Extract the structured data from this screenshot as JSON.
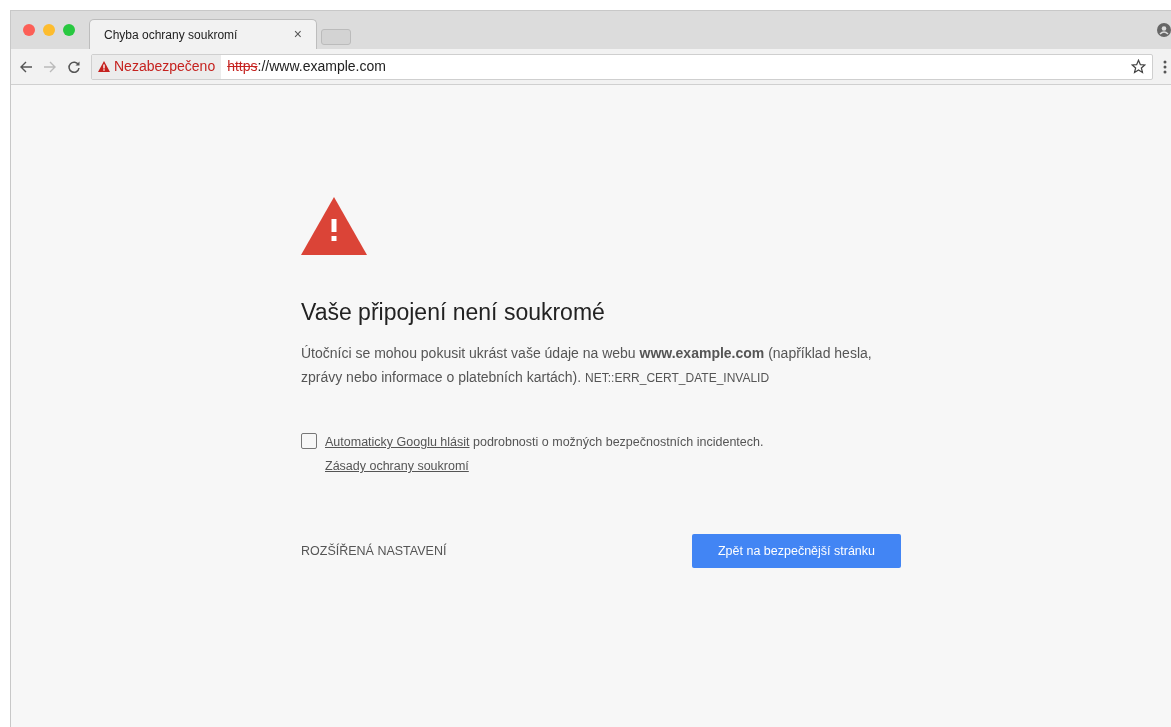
{
  "tabs": [
    {
      "title": "Chyba ochrany soukromí",
      "close": "×",
      "selected": true
    }
  ],
  "toolbar": {
    "security_label": "Nezabezpečeno",
    "url_scheme": "https",
    "scheme_struck": true,
    "url_rest": "://www.example.com"
  },
  "interstitial": {
    "heading": "Vaše připojení není soukromé",
    "description": "Útočníci se mohou pokusit ukrást vaše údaje na webu **www.example.com** (například hesla, zprávy nebo informace o platebních kartách).",
    "error_code": "NET::ERR_CERT_DATE_INVALID",
    "report": {
      "checked": false,
      "link_1": "Automaticky Googlu hlásit",
      "text": "podrobnosti o možných bezpečnostních incidentech.",
      "link_2": "Zásady ochrany soukromí"
    },
    "advanced": "ROZŠÍŘENÁ NASTAVENÍ",
    "back_button": "Zpět na bezpečnější stránku"
  }
}
